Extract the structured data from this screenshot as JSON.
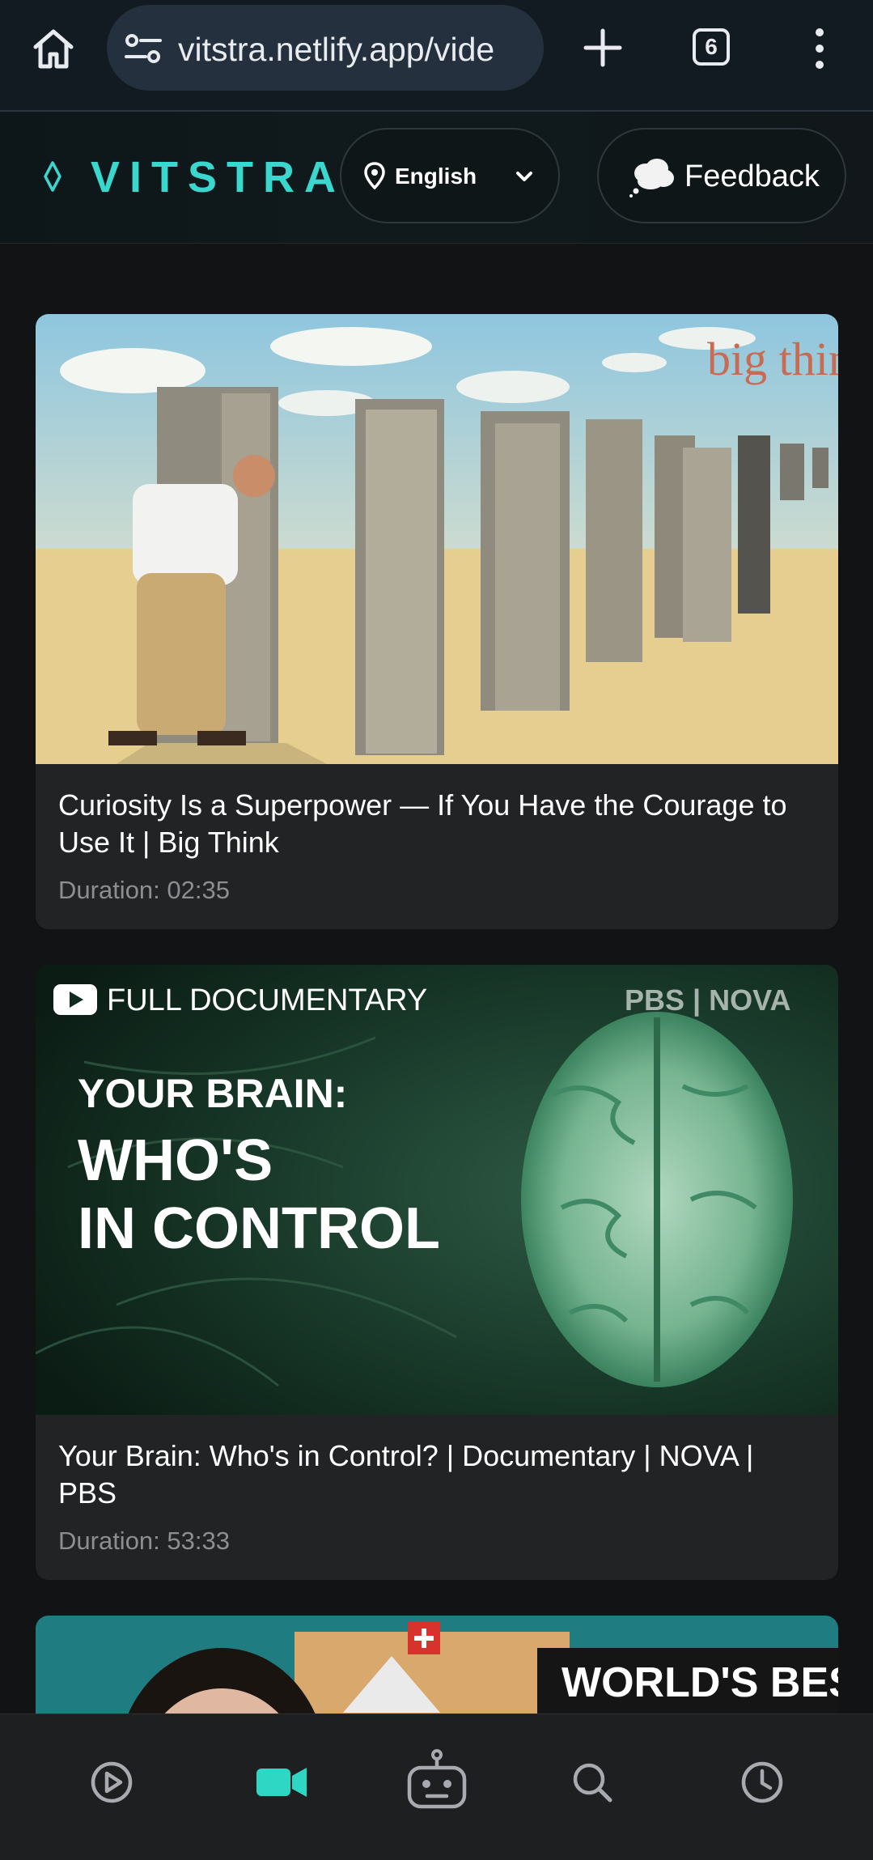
{
  "browser": {
    "url": "vitstra.netlify.app/vide",
    "tab_count": "6",
    "icons": [
      "home-icon",
      "site-settings-icon",
      "new-tab-icon",
      "tab-switcher-icon",
      "more-vert-icon"
    ]
  },
  "header": {
    "logo": "VITSTRA",
    "language": "English",
    "feedback_label": "Feedback",
    "accent_color": "#3ad7cf"
  },
  "videos": [
    {
      "title": "Curiosity Is a Superpower — If You Have the Courage to Use It | Big Think",
      "duration": "Duration: 02:35",
      "thumb_text": "big think"
    },
    {
      "title": "Your Brain: Who's in Control? | Documentary | NOVA | PBS",
      "duration": "Duration: 53:33",
      "thumb_badge": "FULL DOCUMENTARY",
      "thumb_brand": "PBS | NOVA",
      "thumb_line1": "YOUR BRAIN:",
      "thumb_line2": "WHO'S",
      "thumb_line3": "IN CONTROL"
    },
    {
      "thumb_text": "WORLD'S BEST"
    }
  ],
  "nav": {
    "items": [
      "play-icon",
      "video-icon",
      "robot-icon",
      "search-icon",
      "history-icon"
    ],
    "active": "video-icon"
  }
}
